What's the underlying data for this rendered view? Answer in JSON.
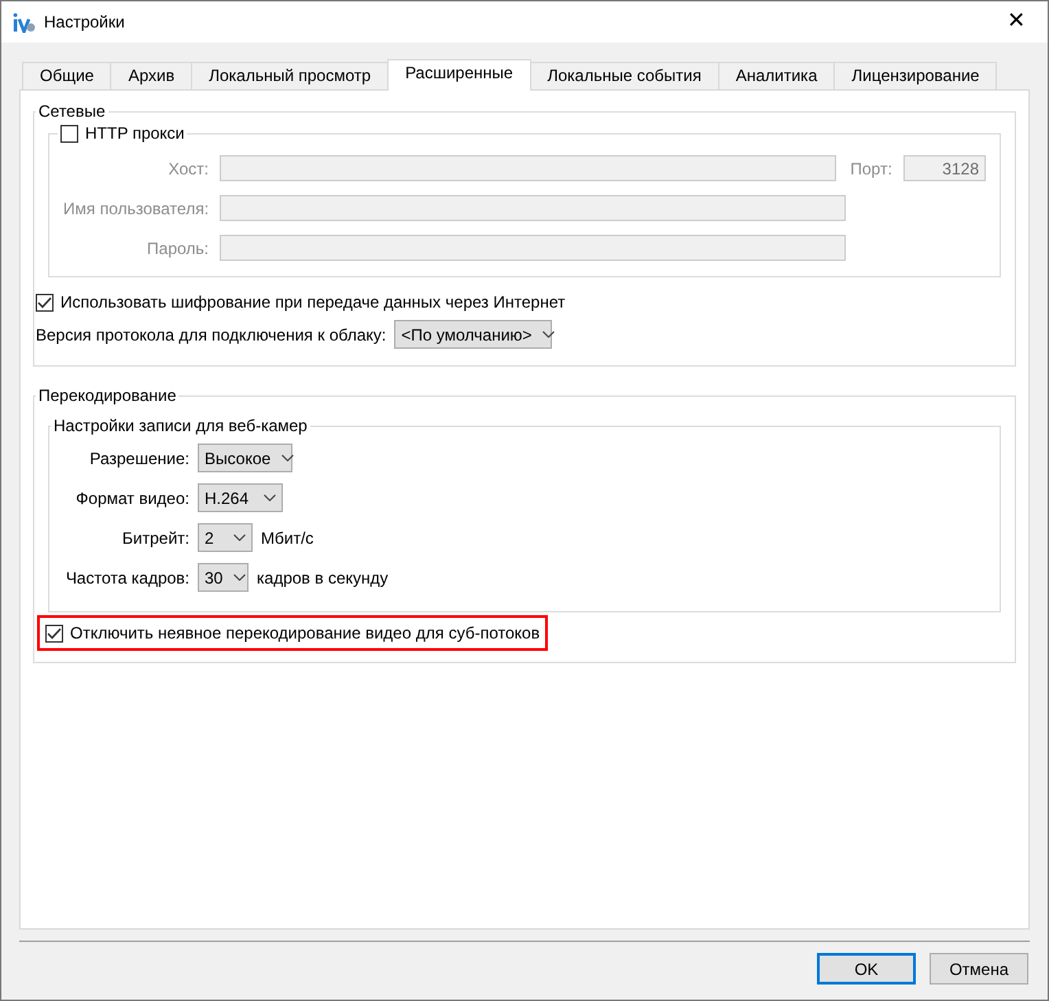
{
  "window": {
    "title": "Настройки",
    "close": "✕"
  },
  "tabs": [
    {
      "label": "Общие",
      "selected": false
    },
    {
      "label": "Архив",
      "selected": false
    },
    {
      "label": "Локальный просмотр",
      "selected": false
    },
    {
      "label": "Расширенные",
      "selected": true
    },
    {
      "label": "Локальные события",
      "selected": false
    },
    {
      "label": "Аналитика",
      "selected": false
    },
    {
      "label": "Лицензирование",
      "selected": false
    }
  ],
  "network": {
    "title": "Сетевые",
    "proxy": {
      "label": "HTTP прокси",
      "checked": false,
      "fields": [
        {
          "label": "Хост:",
          "disabled": true
        },
        {
          "label": "Имя пользователя:",
          "disabled": true
        },
        {
          "label": "Пароль:",
          "disabled": true
        }
      ],
      "port": {
        "label": "Порт:",
        "value": "3128",
        "disabled": true
      }
    },
    "encryption": {
      "label": "Использовать шифрование при передаче данных через Интернет",
      "checked": true
    },
    "protocol": {
      "label": "Версия протокола для подключения к облаку:",
      "value": "<По умолчанию>"
    }
  },
  "transcoding": {
    "title": "Перекодирование",
    "webcam": {
      "title": "Настройки записи для веб-камер",
      "rows": [
        {
          "label": "Разрешение:",
          "value": "Высокое"
        },
        {
          "label": "Формат видео:",
          "value": "H.264"
        },
        {
          "label": "Битрейт:",
          "value": "2",
          "unit": "Мбит/с"
        },
        {
          "label": "Частота кадров:",
          "value": "30",
          "unit": "кадров в секунду"
        }
      ]
    },
    "subchannels": {
      "label": "Отключить неявное перекодирование видео для суб-потоков",
      "checked": true,
      "highlighted": true
    }
  },
  "buttons": [
    {
      "label": "OK",
      "default": true
    },
    {
      "label": "Отмена",
      "default": false
    }
  ]
}
